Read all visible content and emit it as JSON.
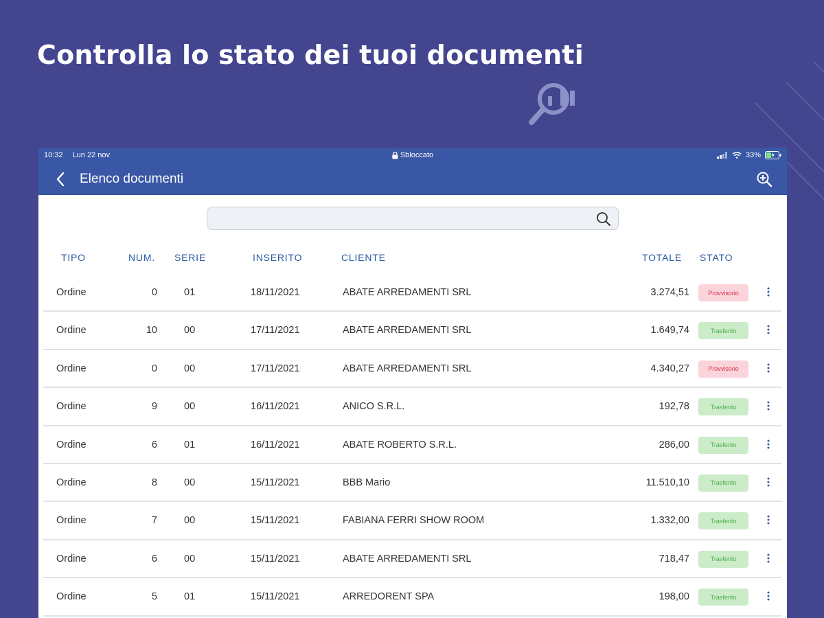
{
  "hero": {
    "title": "Controlla lo stato dei tuoi documenti"
  },
  "status_bar": {
    "time": "10:32",
    "date": "Lun 22 nov",
    "lock_label": "Sbloccato",
    "battery": "33%"
  },
  "app_bar": {
    "title": "Elenco documenti"
  },
  "search": {
    "value": "",
    "placeholder": ""
  },
  "columns": {
    "tipo": "TIPO",
    "num": "NUM.",
    "serie": "SERIE",
    "inserito": "INSERITO",
    "cliente": "CLIENTE",
    "totale": "TOTALE",
    "stato": "STATO"
  },
  "rows": [
    {
      "tipo": "Ordine",
      "num": "0",
      "serie": "01",
      "inserito": "18/11/2021",
      "cliente": "ABATE ARREDAMENTI SRL",
      "totale": "3.274,51",
      "stato": "Provvisorio"
    },
    {
      "tipo": "Ordine",
      "num": "10",
      "serie": "00",
      "inserito": "17/11/2021",
      "cliente": "ABATE ARREDAMENTI SRL",
      "totale": "1.649,74",
      "stato": "Trasferito"
    },
    {
      "tipo": "Ordine",
      "num": "0",
      "serie": "00",
      "inserito": "17/11/2021",
      "cliente": "ABATE ARREDAMENTI SRL",
      "totale": "4.340,27",
      "stato": "Provvisorio"
    },
    {
      "tipo": "Ordine",
      "num": "9",
      "serie": "00",
      "inserito": "16/11/2021",
      "cliente": "ANICO S.R.L.",
      "totale": "192,78",
      "stato": "Trasferito"
    },
    {
      "tipo": "Ordine",
      "num": "6",
      "serie": "01",
      "inserito": "16/11/2021",
      "cliente": "ABATE ROBERTO S.R.L.",
      "totale": "286,00",
      "stato": "Trasferito"
    },
    {
      "tipo": "Ordine",
      "num": "8",
      "serie": "00",
      "inserito": "15/11/2021",
      "cliente": "BBB Mario",
      "totale": "11.510,10",
      "stato": "Trasferito"
    },
    {
      "tipo": "Ordine",
      "num": "7",
      "serie": "00",
      "inserito": "15/11/2021",
      "cliente": "FABIANA FERRI SHOW ROOM",
      "totale": "1.332,00",
      "stato": "Trasferito"
    },
    {
      "tipo": "Ordine",
      "num": "6",
      "serie": "00",
      "inserito": "15/11/2021",
      "cliente": "ABATE ARREDAMENTI SRL",
      "totale": "718,47",
      "stato": "Trasferito"
    },
    {
      "tipo": "Ordine",
      "num": "5",
      "serie": "01",
      "inserito": "15/11/2021",
      "cliente": "ARREDORENT SPA",
      "totale": "198,00",
      "stato": "Trasferito"
    }
  ],
  "badge_styles": {
    "Provvisorio": {
      "bg": "#fbd3da",
      "fg": "#d8344f"
    },
    "Trasferito": {
      "bg": "#ccecc9",
      "fg": "#4caf50"
    }
  },
  "colors": {
    "background": "#43458f",
    "app_bar": "#3a57a5",
    "header_text": "#2b5aa0",
    "kebab": "#3a57a5"
  },
  "icons": {
    "back": "chevron-left-icon",
    "zoom": "zoom-in-icon",
    "search": "search-icon",
    "row_menu": "kebab-icon",
    "decor": "magnifier-chart-icon"
  }
}
